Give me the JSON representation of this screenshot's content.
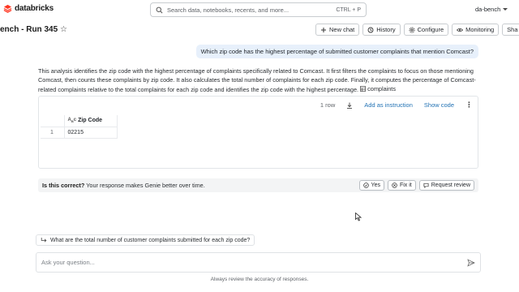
{
  "app": {
    "logo_text": "databricks",
    "workspace": "da-bench"
  },
  "search": {
    "placeholder": "Search data, notebooks, recents, and more...",
    "shortcut": "CTRL + P"
  },
  "page": {
    "title": "ench - Run 345"
  },
  "toolbar": {
    "new_chat": "New chat",
    "history": "History",
    "configure": "Configure",
    "monitoring": "Monitoring",
    "share": "Sha"
  },
  "conversation": {
    "question": "Which zip code has the highest percentage of submitted customer complaints that mention Comcast?",
    "answer": "This analysis identifies the zip code with the highest percentage of complaints specifically related to Comcast. It first filters the complaints to focus on those mentioning Comcast, then counts these complaints by zip code. It also calculates the total number of complaints for each zip code. Finally, it computes the percentage of Comcast-related complaints relative to the total complaints for each zip code and identifies the zip code with the highest percentage.",
    "table_chip": "complaints"
  },
  "result": {
    "row_count": "1 row",
    "add_instruction": "Add as instruction",
    "show_code": "Show code",
    "columns": [
      "Zip Code"
    ],
    "rows": [
      {
        "index": "1",
        "values": [
          "02215"
        ]
      }
    ]
  },
  "feedback": {
    "question_bold": "Is this correct?",
    "question_rest": " Your response makes Genie better over time.",
    "yes": "Yes",
    "fix_it": "Fix it",
    "request_review": "Request review"
  },
  "suggestion": "What are the total number of customer complaints submitted for each zip code?",
  "ask": {
    "placeholder": "Ask your question...",
    "disclaimer": "Always review the accuracy of responses."
  },
  "colors": {
    "accent": "#2272b4",
    "bubble": "#e7f0fb",
    "logo": "#ff3621"
  },
  "icons": [
    "databricks-logo-icon",
    "search-icon",
    "star-icon",
    "plus-icon",
    "history-icon",
    "gear-icon",
    "eye-icon",
    "table-icon",
    "download-icon",
    "kebab-icon",
    "check-circle-icon",
    "fix-icon",
    "chat-icon",
    "reply-arrow-icon",
    "send-icon",
    "cursor-icon"
  ]
}
